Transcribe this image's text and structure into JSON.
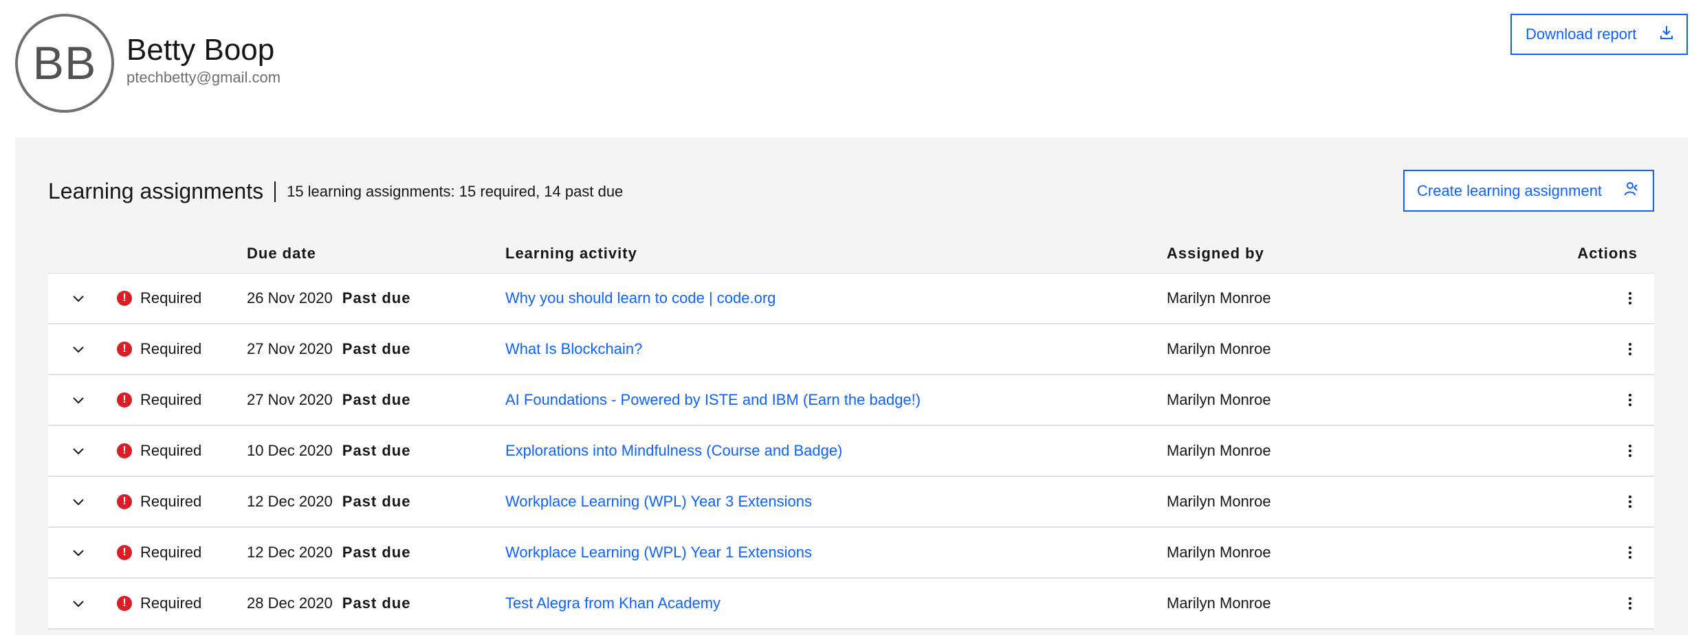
{
  "profile": {
    "initials": "BB",
    "name": "Betty Boop",
    "email": "ptechbetty@gmail.com"
  },
  "toolbar": {
    "download_label": "Download report",
    "download_icon": "download-icon"
  },
  "assignments": {
    "title": "Learning assignments",
    "separator": "|",
    "summary": "15 learning assignments: 15 required, 14 past due",
    "create_label": "Create learning assignment",
    "create_icon": "add-user-icon",
    "columns": {
      "due_date": "Due date",
      "learning_activity": "Learning activity",
      "assigned_by": "Assigned by",
      "actions": "Actions"
    },
    "rows": [
      {
        "status": "Required",
        "date": "26 Nov 2020",
        "due_status": "Past due",
        "activity": "Why you should learn to code | code.org",
        "assigned_by": "Marilyn Monroe"
      },
      {
        "status": "Required",
        "date": "27 Nov 2020",
        "due_status": "Past due",
        "activity": "What Is Blockchain?",
        "assigned_by": "Marilyn Monroe"
      },
      {
        "status": "Required",
        "date": "27 Nov 2020",
        "due_status": "Past due",
        "activity": "AI Foundations - Powered by ISTE and IBM (Earn the badge!)",
        "assigned_by": "Marilyn Monroe"
      },
      {
        "status": "Required",
        "date": "10 Dec 2020",
        "due_status": "Past due",
        "activity": "Explorations into Mindfulness (Course and Badge)",
        "assigned_by": "Marilyn Monroe"
      },
      {
        "status": "Required",
        "date": "12 Dec 2020",
        "due_status": "Past due",
        "activity": "Workplace Learning (WPL) Year 3 Extensions",
        "assigned_by": "Marilyn Monroe"
      },
      {
        "status": "Required",
        "date": "12 Dec 2020",
        "due_status": "Past due",
        "activity": "Workplace Learning (WPL) Year 1 Extensions",
        "assigned_by": "Marilyn Monroe"
      },
      {
        "status": "Required",
        "date": "28 Dec 2020",
        "due_status": "Past due",
        "activity": "Test Alegra from Khan Academy",
        "assigned_by": "Marilyn Monroe"
      }
    ]
  },
  "colors": {
    "accent": "#0f62fe",
    "error": "#da1e28",
    "panel_bg": "#f4f4f4",
    "avatar_border": "#6f6f6f"
  }
}
